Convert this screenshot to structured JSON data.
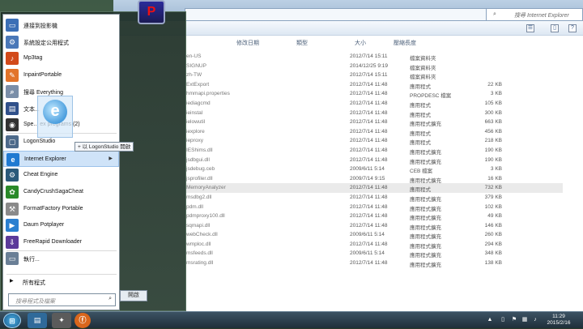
{
  "explorer": {
    "search_placeholder": "搜尋 Internet Explorer",
    "open_button": "開啟",
    "headers": {
      "date": "修改日期",
      "type": "類型",
      "size": "大小",
      "compressed": "壓縮長度"
    },
    "rows": [
      {
        "name": "en-US",
        "date": "2012/7/14 15:11",
        "type": "檔案資料夾",
        "size": ""
      },
      {
        "name": "SIGNUP",
        "date": "2014/12/25 9:19",
        "type": "檔案資料夾",
        "size": ""
      },
      {
        "name": "zh-TW",
        "date": "2012/7/14 15:11",
        "type": "檔案資料夾",
        "size": ""
      },
      {
        "name": "ExtExport",
        "date": "2012/7/14 11:48",
        "type": "應用程式",
        "size": "22 KB"
      },
      {
        "name": "hmmapi.properties",
        "date": "2012/7/14 11:48",
        "type": "PROPDESC 檔案",
        "size": "3 KB"
      },
      {
        "name": "iediagcmd",
        "date": "2012/7/14 11:48",
        "type": "應用程式",
        "size": "105 KB"
      },
      {
        "name": "ieinstal",
        "date": "2012/7/14 11:48",
        "type": "應用程式",
        "size": "300 KB"
      },
      {
        "name": "ielowutil",
        "date": "2012/7/14 11:48",
        "type": "應用程式擴充",
        "size": "663 KB"
      },
      {
        "name": "iexplore",
        "date": "2012/7/14 11:48",
        "type": "應用程式",
        "size": "456 KB"
      },
      {
        "name": "ieproxy",
        "date": "2012/7/14 11:48",
        "type": "應用程式",
        "size": "218 KB"
      },
      {
        "name": "IEShims.dll",
        "date": "2012/7/14 11:48",
        "type": "應用程式擴充",
        "size": "190 KB"
      },
      {
        "name": "jsdbgui.dll",
        "date": "2012/7/14 11:48",
        "type": "應用程式擴充",
        "size": "190 KB"
      },
      {
        "name": "jsdebug.ceb",
        "date": "2009/6/11 5:14",
        "type": "CEB 檔案",
        "size": "3 KB"
      },
      {
        "name": "jsprofiler.dll",
        "date": "2009/7/14 9:15",
        "type": "應用程式擴充",
        "size": "16 KB"
      },
      {
        "name": "MemoryAnalyzer",
        "date": "2012/7/14 11:48",
        "type": "應用程式",
        "size": "732 KB"
      },
      {
        "name": "msdbg2.dll",
        "date": "2012/7/14 11:48",
        "type": "應用程式擴充",
        "size": "379 KB"
      },
      {
        "name": "pdm.dll",
        "date": "2012/7/14 11:48",
        "type": "應用程式擴充",
        "size": "102 KB"
      },
      {
        "name": "pdmproxy100.dll",
        "date": "2012/7/14 11:48",
        "type": "應用程式擴充",
        "size": "49 KB"
      },
      {
        "name": "sqmapi.dll",
        "date": "2012/7/14 11:48",
        "type": "應用程式擴充",
        "size": "146 KB"
      },
      {
        "name": "webCheck.dll",
        "date": "2009/6/11 5:14",
        "type": "應用程式擴充",
        "size": "260 KB"
      },
      {
        "name": "wmploc.dll",
        "date": "2012/7/14 11:48",
        "type": "應用程式擴充",
        "size": "294 KB"
      },
      {
        "name": "msfeeds.dll",
        "date": "2009/6/11 5:14",
        "type": "應用程式擴充",
        "size": "348 KB"
      },
      {
        "name": "msrating.dll",
        "date": "2012/7/14 11:48",
        "type": "應用程式擴充",
        "size": "138 KB"
      }
    ]
  },
  "start_menu": {
    "items": [
      {
        "label": "連接到投影機",
        "icon": "projector-icon",
        "color": "#3b6fb6",
        "glyph": "▭"
      },
      {
        "label": "系統設定公用程式",
        "icon": "system-config-icon",
        "color": "#4a78b8",
        "glyph": "⚙"
      },
      {
        "label": "Mp3tag",
        "icon": "mp3tag-icon",
        "color": "#d24a1a",
        "glyph": "♪"
      },
      {
        "label": "InpaintPortable",
        "icon": "inpaint-icon",
        "color": "#e2742a",
        "glyph": "✎"
      },
      {
        "label": "搜尋 Everything",
        "icon": "everything-search-icon",
        "color": "#7a8ea8",
        "glyph": "⌕"
      },
      {
        "label": "文本...",
        "icon": "text-icon",
        "color": "#30508a",
        "glyph": "▤"
      },
      {
        "label": "Spe... ex programs (2)",
        "icon": "speed-icon",
        "color": "#333333",
        "glyph": "◉"
      },
      {
        "label": "LogonStudio",
        "icon": "logonstudio-icon",
        "color": "#4d6a8a",
        "glyph": "▢"
      },
      {
        "label": "Internet Explorer",
        "icon": "internet-explorer-icon",
        "color": "#1f7ad1",
        "glyph": "e",
        "arrow": true
      },
      {
        "label": "Cheat Engine",
        "icon": "cheat-engine-icon",
        "color": "#2b5a7a",
        "glyph": "⚙"
      },
      {
        "label": "CandyCrushSagaCheat",
        "icon": "candy-crush-icon",
        "color": "#2a8a2a",
        "glyph": "✿"
      },
      {
        "label": "FormatFactory Portable",
        "icon": "format-factory-icon",
        "color": "#8a8a8a",
        "glyph": "⚒"
      },
      {
        "label": "Daum Potplayer",
        "icon": "potplayer-icon",
        "color": "#2a7fd0",
        "glyph": "▶"
      },
      {
        "label": "FreeRapid Downloader",
        "icon": "freerapid-icon",
        "color": "#5b3a9a",
        "glyph": "⇩"
      },
      {
        "label": "執行...",
        "icon": "run-icon",
        "color": "#6a7f96",
        "glyph": "▭"
      }
    ],
    "all_programs": "所有程式",
    "search_placeholder": "搜尋程式及檔案",
    "tooltip": "以 LogonStudio 開啟"
  },
  "taskbar": {
    "time": "11:29",
    "date": "2015/2/16"
  }
}
